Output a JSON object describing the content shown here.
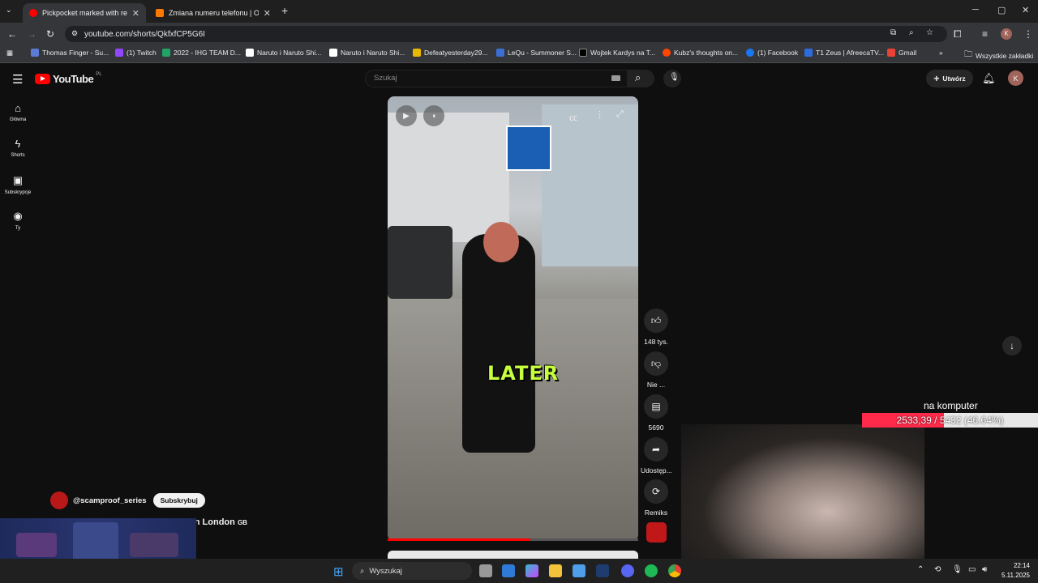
{
  "browser": {
    "tabs": [
      {
        "title": "Pickpocket marked with red pa",
        "active": true
      },
      {
        "title": "Zmiana numeru telefonu | Oran",
        "active": false
      }
    ],
    "url": "youtube.com/shorts/QkfxfCP5G6I",
    "bookmarks": [
      "Thomas Finger - Su...",
      "(1) Twitch",
      "2022 - IHG TEAM D...",
      "Naruto i Naruto Shi...",
      "Naruto i Naruto Shi...",
      "Defeatyesterday29...",
      "LeQu - Summoner S...",
      "Wojtek Kardys na T...",
      "Kubz's thoughts on...",
      "(1) Facebook",
      "T1 Zeus | AfreecaTV...",
      "Gmail"
    ],
    "bookmarks_all": "Wszystkie zakładki"
  },
  "youtube": {
    "logo_text": "YouTube",
    "logo_region": "PL",
    "search_placeholder": "Szukaj",
    "create_label": "Utwórz",
    "avatar_letter": "K",
    "sidebar": [
      {
        "label": "Główna",
        "icon": "home-icon"
      },
      {
        "label": "Shorts",
        "icon": "shorts-icon"
      },
      {
        "label": "Subskrypcje",
        "icon": "subscriptions-icon"
      },
      {
        "label": "Ty",
        "icon": "you-icon"
      }
    ],
    "short": {
      "caption_overlay": "LATER",
      "progress": 0.57,
      "actions": {
        "like_count": "148 tys.",
        "dislike_label": "Nie ...",
        "comment_count": "5690",
        "share_label": "Udostęp...",
        "remix_label": "Remiks"
      },
      "channel": "@scamproof_series",
      "subscribe_label": "Subskrybuj",
      "title_visible": "t in London",
      "title_flag": "GB"
    }
  },
  "stream_overlay": {
    "goal_label": "na komputer",
    "goal_text": "2533,39 / 5432 (46.64%)",
    "goal_fraction": 0.4664
  },
  "taskbar": {
    "search_label": "Wyszukaj",
    "time": "22:14",
    "date": "5.11.2025"
  }
}
